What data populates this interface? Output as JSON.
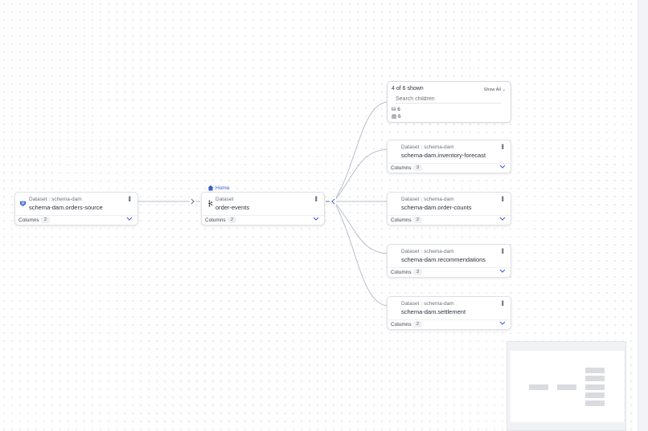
{
  "upstream": {
    "type": "Dataset",
    "platform": "schema-dam",
    "name": "schema-dam.orders-source",
    "columns_label": "Columns",
    "columns_count": "2"
  },
  "center": {
    "home_label": "Home",
    "type": "Dataset",
    "name": "order-events",
    "columns_label": "Columns",
    "columns_count": "2"
  },
  "children_panel": {
    "count_text": "4 of 6 shown",
    "show_all": "Show All",
    "search_placeholder": "Search children",
    "stat1": "6",
    "stat2": "6"
  },
  "children": [
    {
      "type": "Dataset",
      "platform": "schema-dam",
      "name": "schema-dam.inventory-forecast",
      "columns_label": "Columns",
      "columns_count": "3"
    },
    {
      "type": "Dataset",
      "platform": "schema-dam",
      "name": "schema-dam.order-counts",
      "columns_label": "Columns",
      "columns_count": "2"
    },
    {
      "type": "Dataset",
      "platform": "schema-dam",
      "name": "schema-dam.recommendations",
      "columns_label": "Columns",
      "columns_count": "3"
    },
    {
      "type": "Dataset",
      "platform": "schema-dam",
      "name": "schema-dam.settlement",
      "columns_label": "Columns",
      "columns_count": "2"
    }
  ],
  "colors": {
    "accent": "#3a5bd0",
    "edge": "#b9bec8",
    "brand_icon": "#4a6bd6"
  }
}
